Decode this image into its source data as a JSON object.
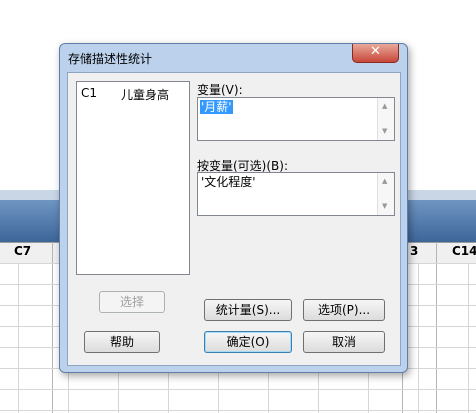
{
  "background": {
    "col_c7": "C7",
    "col_3": "3",
    "col_c14": "C14"
  },
  "dialog": {
    "title": "存储描述性统计",
    "close_symbol": "✕",
    "column_list": [
      {
        "code": "C1",
        "name": "儿童身高"
      }
    ],
    "variables_label": "变量(V):",
    "variables_value": "'月薪'",
    "by_variables_label": "按变量(可选)(B):",
    "by_variables_value": "'文化程度'",
    "select_button": "选择",
    "statistics_button": "统计量(S)...",
    "options_button": "选项(P)...",
    "help_button": "帮助",
    "ok_button": "确定(O)",
    "cancel_button": "取消"
  },
  "colors": {
    "title_bar": "#bcd2ec",
    "selection": "#3399ff",
    "close": "#c7473a"
  }
}
